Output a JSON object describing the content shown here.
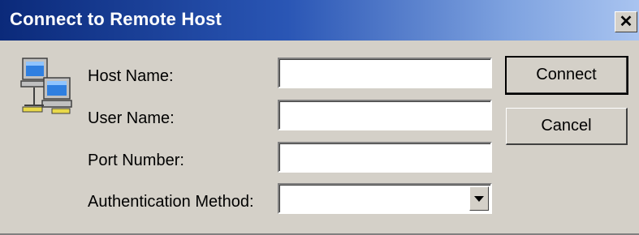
{
  "window": {
    "title": "Connect to Remote Host",
    "close_glyph": "✕",
    "close_icon": "close-icon"
  },
  "icon": "networked-computers-icon",
  "form": {
    "host_name_label": "Host Name:",
    "host_name_value": "",
    "user_name_label": "User Name:",
    "user_name_value": "",
    "port_number_label": "Port Number:",
    "port_number_value": "",
    "auth_method_label": "Authentication Method:",
    "auth_method_value": ""
  },
  "buttons": {
    "connect": "Connect",
    "cancel": "Cancel"
  },
  "colors": {
    "title_bar_start": "#0b2a7a",
    "title_bar_end": "#a9c4f0",
    "dialog_bg": "#d4d0c8"
  }
}
